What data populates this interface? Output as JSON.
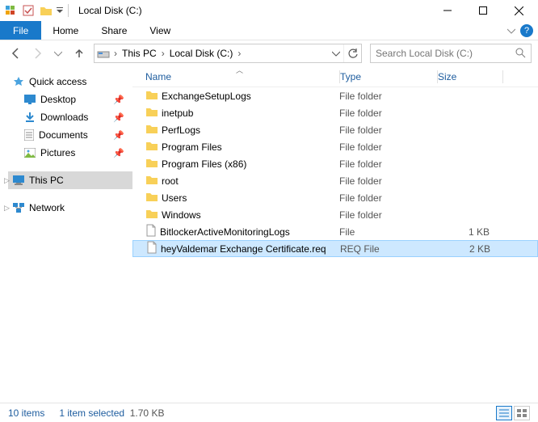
{
  "titlebar": {
    "title": "Local Disk (C:)"
  },
  "ribbon": {
    "tabs": {
      "file": "File",
      "home": "Home",
      "share": "Share",
      "view": "View"
    }
  },
  "address": {
    "crumbs": [
      "This PC",
      "Local Disk (C:)"
    ]
  },
  "search": {
    "placeholder": "Search Local Disk (C:)"
  },
  "sidebar": {
    "quick": "Quick access",
    "desktop": "Desktop",
    "downloads": "Downloads",
    "documents": "Documents",
    "pictures": "Pictures",
    "thispc": "This PC",
    "network": "Network"
  },
  "columns": {
    "name": "Name",
    "type": "Type",
    "size": "Size"
  },
  "rows": [
    {
      "name": "ExchangeSetupLogs",
      "type": "File folder",
      "size": "",
      "kind": "folder"
    },
    {
      "name": "inetpub",
      "type": "File folder",
      "size": "",
      "kind": "folder"
    },
    {
      "name": "PerfLogs",
      "type": "File folder",
      "size": "",
      "kind": "folder"
    },
    {
      "name": "Program Files",
      "type": "File folder",
      "size": "",
      "kind": "folder"
    },
    {
      "name": "Program Files (x86)",
      "type": "File folder",
      "size": "",
      "kind": "folder"
    },
    {
      "name": "root",
      "type": "File folder",
      "size": "",
      "kind": "folder"
    },
    {
      "name": "Users",
      "type": "File folder",
      "size": "",
      "kind": "folder"
    },
    {
      "name": "Windows",
      "type": "File folder",
      "size": "",
      "kind": "folder"
    },
    {
      "name": "BitlockerActiveMonitoringLogs",
      "type": "File",
      "size": "1 KB",
      "kind": "file"
    },
    {
      "name": "heyValdemar Exchange Certificate.req",
      "type": "REQ File",
      "size": "2 KB",
      "kind": "file",
      "selected": true
    }
  ],
  "status": {
    "count": "10 items",
    "selection": "1 item selected",
    "size": "1.70 KB"
  }
}
